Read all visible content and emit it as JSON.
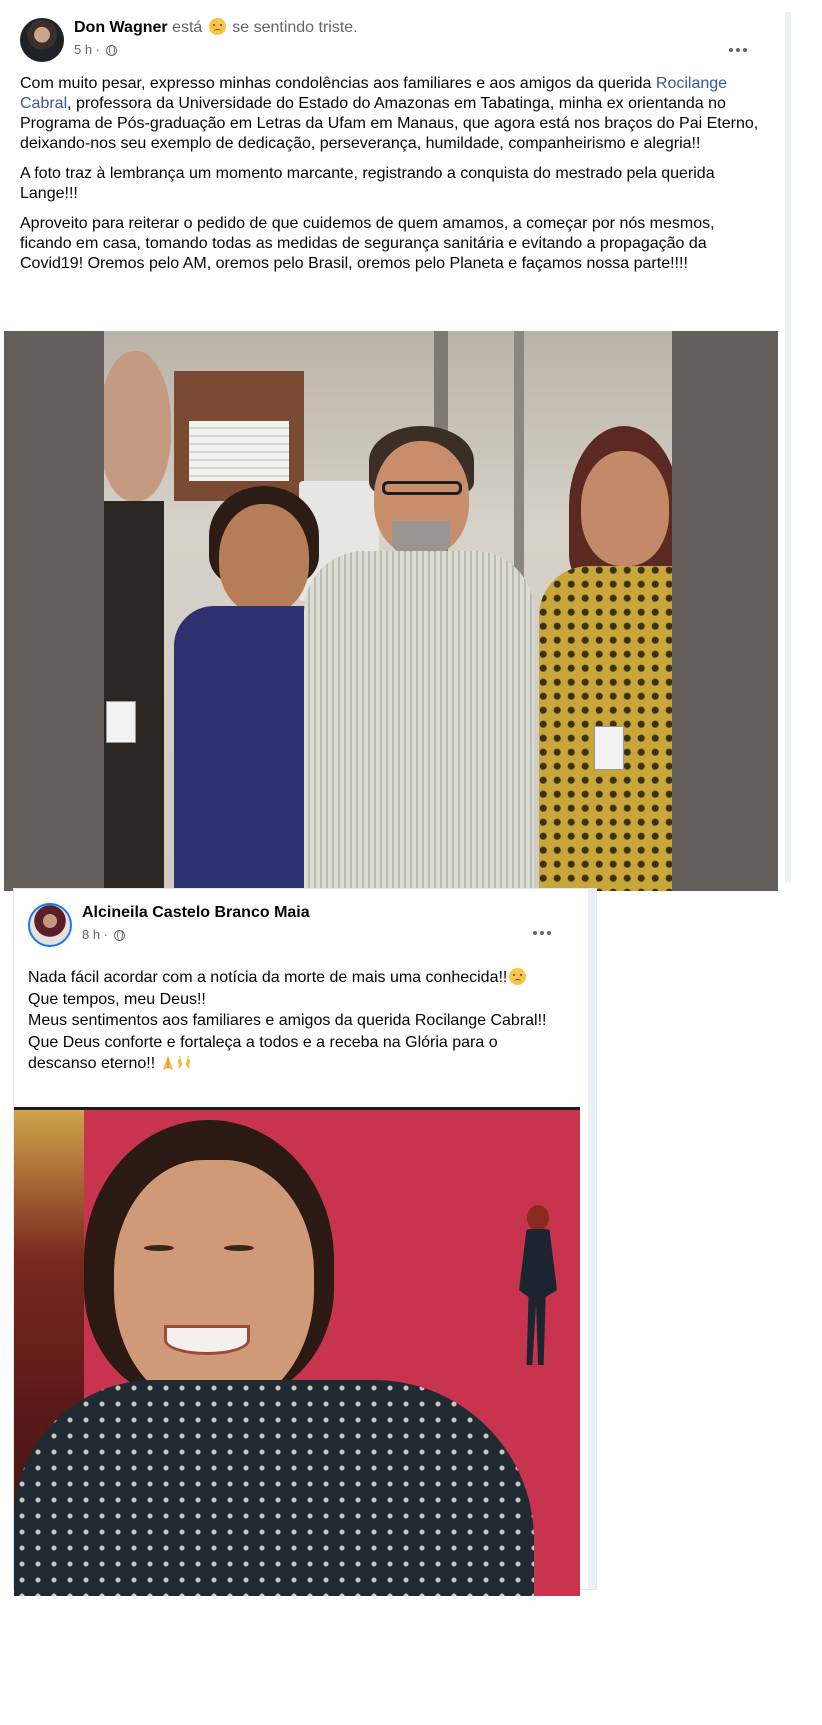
{
  "post1": {
    "author": "Don Wagner",
    "feeling_prefix": "está",
    "feeling_text": "se sentindo triste.",
    "time": "5 h ·",
    "paragraph1_before_link": "Com muito pesar, expresso minhas condolências aos familiares e aos amigos da querida",
    "paragraph1_link": "Rocilange Cabral",
    "paragraph1_after_link": ", professora da Universidade do Estado do Amazonas em Tabatinga, minha ex orientanda no Programa de Pós-graduação em Letras da Ufam em Manaus, que agora está nos braços do Pai Eterno, deixando-nos seu exemplo de dedicação, perseverança, humildade, companheirismo e alegria!!",
    "paragraph2": "A foto traz à lembrança um momento marcante, registrando a conquista do mestrado pela querida Lange!!!",
    "paragraph3": "Aproveito para reiterar o pedido de que cuidemos de quem amamos, a começar por nós mesmos, ficando em casa, tomando todas as medidas de segurança sanitária e evitando a propagação da Covid19! Oremos pelo AM, oremos pelo Brasil, oremos pelo Planeta e façamos nossa parte!!!!"
  },
  "post2": {
    "author": "Alcineila Castelo Branco Maia",
    "time": "8 h ·",
    "line1": "Nada fácil acordar com a notícia da morte de mais uma conhecida!!",
    "line2": "Que tempos, meu Deus!!",
    "line3": "Meus sentimentos aos familiares e amigos da querida Rocilange Cabral!!",
    "line4": "Que Deus conforte e fortaleça a todos e a receba na Glória para o descanso eterno!!"
  },
  "colors": {
    "link": "#385898",
    "secondary_text": "#65676b",
    "photo1_bg": "#645f5c",
    "photo2_bg": "#c8344e"
  }
}
